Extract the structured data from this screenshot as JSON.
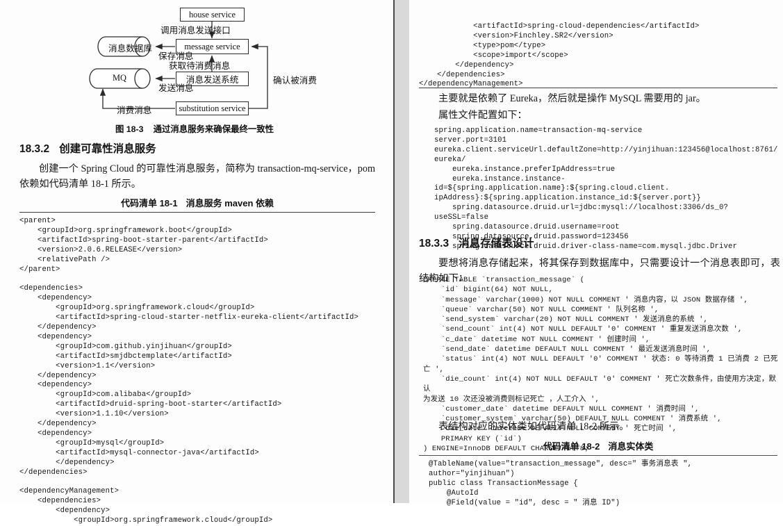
{
  "page": {
    "background": "#fdfdfd",
    "ink": "#161616"
  },
  "figure": {
    "caption_number": "图 18-3",
    "caption_text": "通过消息服务来确保最终一致性",
    "nodes": {
      "house_service": "house service",
      "message_service": "message service",
      "message_db": "消息数据库",
      "mq": "MQ",
      "sender_system": "消息发送系统",
      "substitution_service": "substitution service"
    },
    "edge_labels": {
      "call_send_api": "调用消息发送接口",
      "save_message": "保存消息",
      "fetch_pending": "获取待消费消息",
      "send_message": "发送消息",
      "confirm_consumed": "确认被消费",
      "consume_message": "消费消息"
    }
  },
  "left": {
    "section": {
      "number": "18.3.2",
      "title": "创建可靠性消息服务"
    },
    "paragraph": "创建一个 Spring Cloud 的可靠性消息服务，简称为 transaction-mq-service，pom 依赖如代码清单 18-1 所示。",
    "listing": {
      "number": "代码清单 18-1",
      "title": "消息服务 maven 依赖",
      "code": "<parent>\n    <groupId>org.springframework.boot</groupId>\n    <artifactId>spring-boot-starter-parent</artifactId>\n    <version>2.0.6.RELEASE</version>\n    <relativePath />\n</parent>\n\n<dependencies>\n    <dependency>\n        <groupId>org.springframework.cloud</groupId>\n        <artifactId>spring-cloud-starter-netflix-eureka-client</artifactId>\n    </dependency>\n    <dependency>\n        <groupId>com.github.yinjihuan</groupId>\n        <artifactId>smjdbctemplate</artifactId>\n        <version>1.1</version>\n    </dependency>\n    <dependency>\n        <groupId>com.alibaba</groupId>\n        <artifactId>druid-spring-boot-starter</artifactId>\n        <version>1.1.10</version>\n    </dependency>\n    <dependency>\n        <groupId>mysql</groupId>\n        <artifactId>mysql-connector-java</artifactId>\n        </dependency>\n</dependencies>\n\n<dependencyManagement>\n    <dependencies>\n        <dependency>\n            <groupId>org.springframework.cloud</groupId>"
    }
  },
  "right": {
    "listing_continued_code": "            <artifactId>spring-cloud-dependencies</artifactId>\n            <version>Finchley.SR2</version>\n            <type>pom</type>\n            <scope>import</scope>\n        </dependency>\n    </dependencies>\n</dependencyManagement>",
    "para_after_listing": "主要就是依赖了 Eureka，然后就是操作 MySQL 需要用的 jar。",
    "para_properties_intro": "属性文件配置如下：",
    "properties_code": "spring.application.name=transaction-mq-service\nserver.port=3101\neureka.client.serviceUrl.defaultZone=http://yinjihuan:123456@localhost:8761/\neureka/\n    eureka.instance.preferIpAddress=true\n    eureka.instance.instance-id=${spring.application.name}:${spring.cloud.client.\nipAddress}:${spring.application.instance_id:${server.port}}\n    spring.datasource.druid.url=jdbc:mysql://localhost:3306/ds_0?useSSL=false\n    spring.datasource.druid.username=root\n    spring.datasource.druid.password=123456\n    spring.datasource.druid.driver-class-name=com.mysql.jdbc.Driver",
    "section": {
      "number": "18.3.3",
      "title": "消息存储表设计"
    },
    "paragraph": "要想将消息存储起来，将其保存到数据库中，只需要设计一个消息表即可，表结构如下：",
    "sql_code": "CREATE TABLE `transaction_message` (\n    `id` bigint(64) NOT NULL,\n    `message` varchar(1000) NOT NULL COMMENT ' 消息内容，以 JSON 数据存储 ',\n    `queue` varchar(50) NOT NULL COMMENT ' 队列名称 ',\n    `send_system` varchar(20) NOT NULL COMMENT ' 发送消息的系统 ',\n    `send_count` int(4) NOT NULL DEFAULT '0' COMMENT ' 重复发送消息次数 ',\n    `c_date` datetime NOT NULL COMMENT ' 创建时间 ',\n    `send_date` datetime DEFAULT NULL COMMENT ' 最近发送消息时间 ',\n    `status` int(4) NOT NULL DEFAULT '0' COMMENT ' 状态: 0 等待消费 1 已消费 2 已死亡 ',\n    `die_count` int(4) NOT NULL DEFAULT '0' COMMENT ' 死亡次数条件，由使用方决定，默认\n为发送 10 次还没被消费则标记死亡 ，人工介入 ',\n    `customer_date` datetime DEFAULT NULL COMMENT ' 消费时间 ',\n    `customer_system` varchar(50) DEFAULT NULL COMMENT ' 消费系统 ',\n    `die_date` datetime DEFAULT NULL COMMENT ' 死亡时间 ',\n    PRIMARY KEY (`id`)\n) ENGINE=InnoDB DEFAULT CHARSET=utf8;",
    "para_entity": "表结构对应的实体类如代码清单 18-2 所示。",
    "listing2": {
      "number": "代码清单 18-2",
      "title": "消息实体类",
      "code": "@TableName(value=\"transaction_message\", desc=\" 事务消息表 \",\nauthor=\"yinjihuan\")\npublic class TransactionMessage {\n    @AutoId\n    @Field(value = \"id\", desc = \" 消息 ID\")"
    }
  }
}
